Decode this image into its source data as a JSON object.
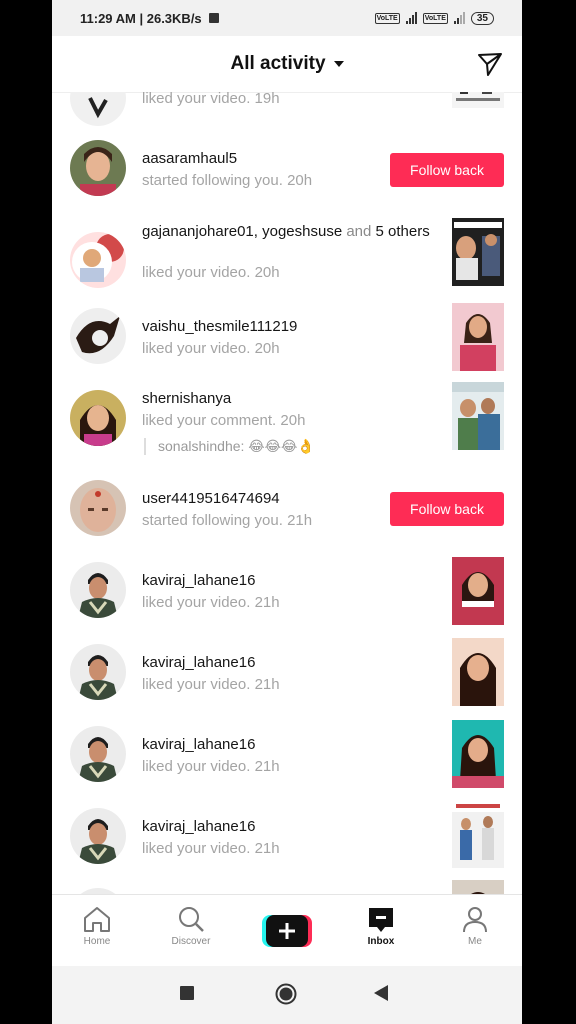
{
  "status_bar": {
    "time_speed": "11:29 AM | 26.3KB/s",
    "battery": "35",
    "network_tag": "VoLTE"
  },
  "header": {
    "title": "All activity"
  },
  "feed": {
    "top_partial_action": "liked your video. 19h",
    "items": [
      {
        "username": "aasaramhaul5",
        "action": "started following you.",
        "time": "20h",
        "button": "Follow back"
      },
      {
        "username": "gajananjohare01, yogeshsuse",
        "and": "and",
        "count": "5",
        "others": "others",
        "action": "liked your video.",
        "time": "20h"
      },
      {
        "username": "vaishu_thesmile111219",
        "action": "liked your video.",
        "time": "20h"
      },
      {
        "username": "shernishanya",
        "action": "liked your comment.",
        "time": "20h",
        "reply": "sonalshindhe: 😂😂😂👌"
      },
      {
        "username": "user4419516474694",
        "action": "started following you.",
        "time": "21h",
        "button": "Follow back"
      },
      {
        "username": "kaviraj_lahane16",
        "action": "liked your video.",
        "time": "21h"
      },
      {
        "username": "kaviraj_lahane16",
        "action": "liked your video.",
        "time": "21h"
      },
      {
        "username": "kaviraj_lahane16",
        "action": "liked your video.",
        "time": "21h"
      },
      {
        "username": "kaviraj_lahane16",
        "action": "liked your video.",
        "time": "21h"
      }
    ]
  },
  "bottom_nav": {
    "home": "Home",
    "discover": "Discover",
    "inbox": "Inbox",
    "me": "Me"
  },
  "colors": {
    "accent": "#fe2c55",
    "muted_text": "#a4a4a4"
  },
  "icons": [
    "send-icon",
    "home-icon",
    "discover-icon",
    "create-icon",
    "inbox-icon",
    "me-icon",
    "square-icon",
    "circle-icon",
    "back-icon"
  ]
}
